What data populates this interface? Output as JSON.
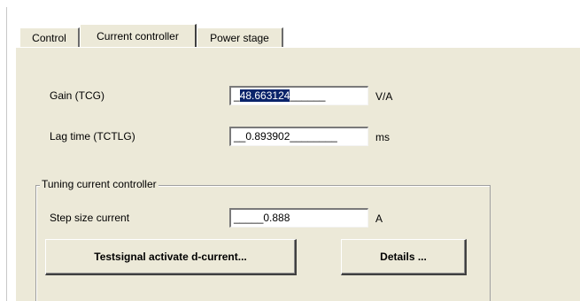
{
  "tabs": [
    {
      "label": "Control"
    },
    {
      "label": "Current controller"
    },
    {
      "label": "Power stage"
    }
  ],
  "fields": {
    "gain": {
      "label": "Gain (TCG)",
      "value_lead": "_",
      "value_selected": "48.663124",
      "value_trail": "______",
      "unit": "V/A"
    },
    "lag_time": {
      "label": "Lag time (TCTLG)",
      "value": "__0.893902________",
      "unit": "ms"
    }
  },
  "tuning": {
    "group_title": "Tuning current controller",
    "step_size": {
      "label": "Step size current",
      "value": "_____0.888",
      "unit": "A"
    },
    "buttons": {
      "testsignal": "Testsignal activate d-current...",
      "details": "Details ..."
    }
  }
}
